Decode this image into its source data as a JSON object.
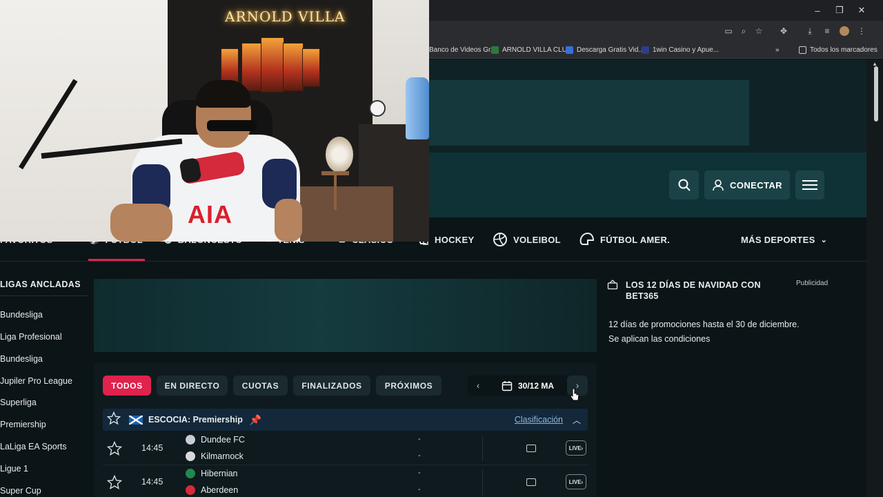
{
  "browser": {
    "window_controls": [
      "–",
      "❐",
      "✕"
    ],
    "bookmarks": [
      {
        "label": "Banco de Videos Gr..."
      },
      {
        "label": "ARNOLD VILLA CLU..."
      },
      {
        "label": "Descarga Gratis Vid..."
      },
      {
        "label": "1win Casino y Apue..."
      }
    ],
    "bookmarks_more": "»",
    "all_bookmarks": "Todos los marcadores"
  },
  "webcam": {
    "neon_sign": "ARNOLD VILLA",
    "shirt_text": "AIA"
  },
  "header": {
    "connect_label": "CONECTAR"
  },
  "sports_nav": {
    "items": [
      {
        "label": "FAVORITOS"
      },
      {
        "label": "FÚTBOL"
      },
      {
        "label": "BALONCESTO"
      },
      {
        "label": "TENIS"
      },
      {
        "label": "CLÁSICO"
      },
      {
        "label": "HOCKEY"
      },
      {
        "label": "VOLEIBOL"
      },
      {
        "label": "FÚTBOL AMER."
      }
    ],
    "more_label": "MÁS DEPORTES"
  },
  "sidebar": {
    "title": "LIGAS ANCLADAS",
    "items": [
      {
        "label": "Bundesliga"
      },
      {
        "label": "Liga Profesional"
      },
      {
        "label": "Bundesliga"
      },
      {
        "label": "Jupiler Pro League"
      },
      {
        "label": "Superliga"
      },
      {
        "label": "Premiership"
      },
      {
        "label": "LaLiga EA Sports"
      },
      {
        "label": "Ligue 1"
      },
      {
        "label": "Super Cup"
      }
    ]
  },
  "filters": {
    "items": [
      {
        "label": "TODOS",
        "active": true
      },
      {
        "label": "EN DIRECTO",
        "active": false
      },
      {
        "label": "CUOTAS",
        "active": false
      },
      {
        "label": "FINALIZADOS",
        "active": false
      },
      {
        "label": "PRÓXIMOS",
        "active": false
      }
    ],
    "date_label": "30/12 MA"
  },
  "league": {
    "name": "ESCOCIA: Premiership",
    "standings_label": "Clasificación"
  },
  "matches": [
    {
      "time": "14:45",
      "home": "Dundee FC",
      "away": "Kilmarnock",
      "home_score": "-",
      "away_score": "-",
      "home_color": "#c7ccd6",
      "away_color": "#d8d8d8"
    },
    {
      "time": "14:45",
      "home": "Hibernian",
      "away": "Aberdeen",
      "home_color": "#1e8a4c",
      "away_color": "#d42a3b",
      "home_score": "-",
      "away_score": "-"
    }
  ],
  "live_label": "LIVE",
  "ad": {
    "title": "LOS 12 DÍAS DE NAVIDAD CON BET365",
    "badge": "Publicidad",
    "line1": "12 días de promociones hasta el 30 de diciembre.",
    "line2": "Se aplican las condiciones"
  },
  "colors": {
    "accent": "#e0224d",
    "background": "#0b1417",
    "header": "#0f3236"
  }
}
